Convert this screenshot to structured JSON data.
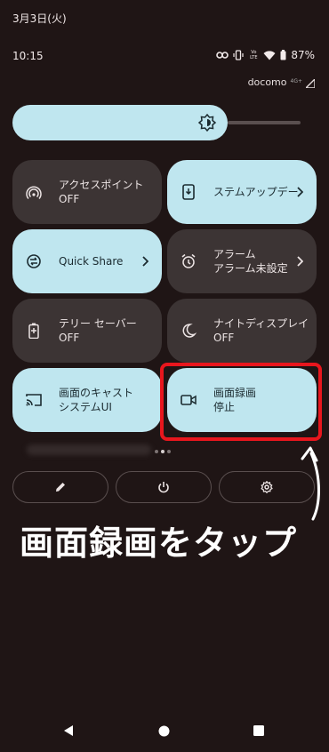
{
  "status": {
    "date": "3月3日(火)",
    "time": "10:15",
    "battery": "87%",
    "carrier": "docomo",
    "network_label": "4G+",
    "volte_label": "Vo LTE"
  },
  "tiles": [
    {
      "title": "アクセスポイント",
      "subtitle": "OFF",
      "icon": "hotspot-icon",
      "state": "off",
      "chevron": false
    },
    {
      "title": "ステムアップデー",
      "subtitle": "",
      "icon": "system-update-icon",
      "state": "on",
      "chevron": true
    },
    {
      "title": "Quick Share",
      "subtitle": "",
      "icon": "quick-share-icon",
      "state": "on",
      "chevron": true
    },
    {
      "title": "アラーム",
      "subtitle": "アラーム未設定",
      "icon": "alarm-icon",
      "state": "off",
      "chevron": true
    },
    {
      "title": "テリー セーバー",
      "subtitle": "OFF",
      "icon": "battery-saver-icon",
      "state": "off",
      "chevron": false
    },
    {
      "title": "ナイトディスプレイ",
      "subtitle": "OFF",
      "icon": "night-display-icon",
      "state": "off",
      "chevron": false
    },
    {
      "title": "画面のキャスト",
      "subtitle": "システムUI",
      "icon": "cast-icon",
      "state": "on",
      "chevron": false
    },
    {
      "title": "画面録画",
      "subtitle": "停止",
      "icon": "screen-record-icon",
      "state": "on",
      "chevron": false
    }
  ],
  "caption": "画面録画をタップ",
  "colors": {
    "background": "#1f1515",
    "tile_on": "#bfe6ef",
    "tile_off": "#3c3434",
    "highlight": "#e8161d"
  }
}
